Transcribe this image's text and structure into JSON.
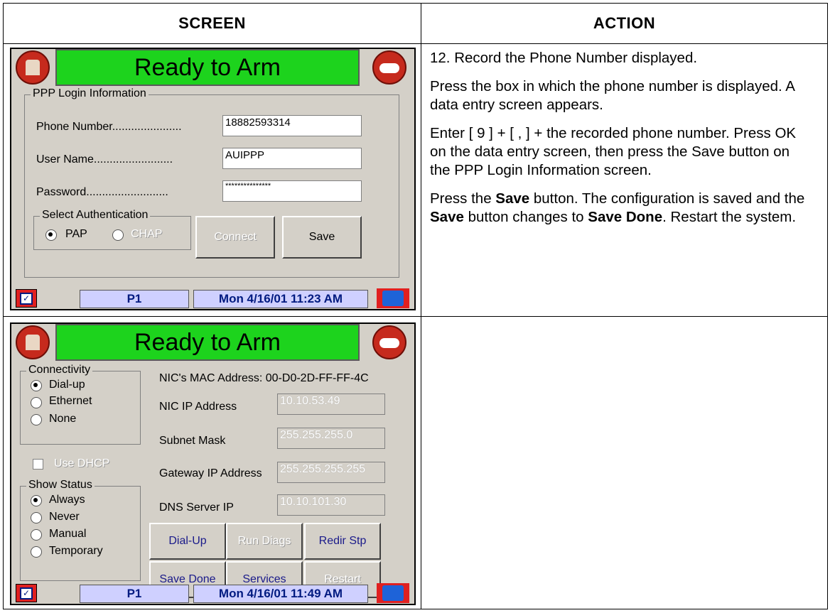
{
  "table": {
    "header_screen": "SCREEN",
    "header_action": "ACTION"
  },
  "action": {
    "p1": "12.  Record the Phone Number displayed.",
    "p2": "Press the box in which the phone number is displayed. A data entry screen appears.",
    "p3": "Enter [ 9 ] + [ , ] + the recorded phone number. Press OK on the data entry screen, then press the Save button on the PPP Login Information screen.",
    "p4_a": "Press the ",
    "p4_b": "Save",
    "p4_c": " button.  The configuration is saved and the ",
    "p4_d": "Save",
    "p4_e": " button changes to ",
    "p4_f": "Save Done",
    "p4_g": ".  Restart the system."
  },
  "screen1": {
    "banner": "Ready to Arm",
    "group_title": "PPP Login Information",
    "phone_label": "Phone Number......................",
    "phone_value": "18882593314",
    "user_label": "User Name.........................",
    "user_value": "AUIPPP",
    "password_label": "Password..........................",
    "password_value": "***************",
    "auth_title": "Select Authentication",
    "pap": "PAP",
    "chap": "CHAP",
    "connect": "Connect",
    "save": "Save",
    "status_p": "P1",
    "status_datetime": "Mon 4/16/01 11:23 AM"
  },
  "screen2": {
    "banner": "Ready to Arm",
    "connectivity_title": "Connectivity",
    "dialup": "Dial-up",
    "ethernet": "Ethernet",
    "none": "None",
    "use_dhcp": "Use DHCP",
    "show_status_title": "Show Status",
    "always": "Always",
    "never": "Never",
    "manual": "Manual",
    "temporary": "Temporary",
    "mac_label": "NIC's MAC Address: 00-D0-2D-FF-FF-4C",
    "nic_ip_label": "NIC IP Address",
    "nic_ip_value": "10.10.53.49",
    "subnet_label": "Subnet Mask",
    "subnet_value": "255.255.255.0",
    "gateway_label": "Gateway IP Address",
    "gateway_value": "255.255.255.255",
    "dns_label": "DNS Server IP",
    "dns_value": "10.10.101.30",
    "btn_dialup": "Dial-Up",
    "btn_rundiags": "Run Diags",
    "btn_redir": "Redir Stp",
    "btn_savedone": "Save Done",
    "btn_services": "Services",
    "btn_restart": "Restart",
    "status_p": "P1",
    "status_datetime": "Mon 4/16/01 11:49 AM"
  }
}
